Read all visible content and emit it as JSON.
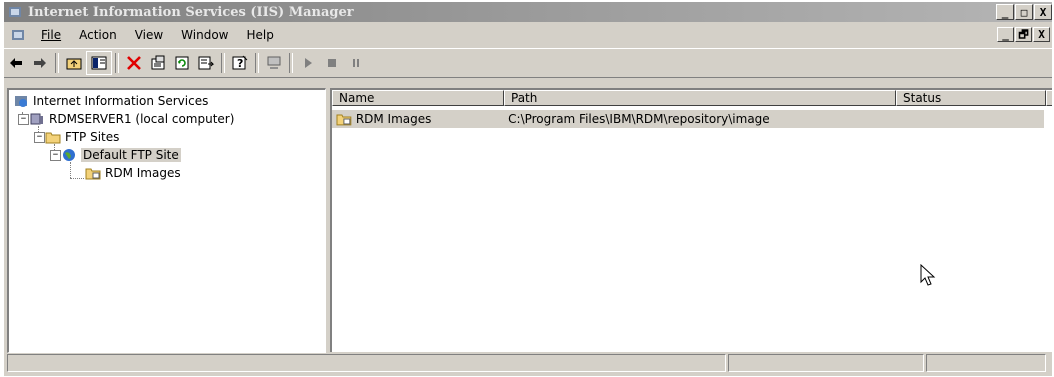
{
  "window": {
    "title": "Internet Information Services (IIS) Manager"
  },
  "caption_buttons": [
    "_",
    "□",
    "X"
  ],
  "mdi_buttons": [
    "_",
    "🗗",
    "X"
  ],
  "menu": [
    "File",
    "Action",
    "View",
    "Window",
    "Help"
  ],
  "toolbar": [
    "back-icon",
    "forward-icon",
    "up-folder-icon",
    "show-tree-icon",
    "delete-icon",
    "properties-icon",
    "refresh-icon",
    "export-list-icon",
    "help-icon",
    "computer-icon",
    "play-icon",
    "stop-icon",
    "pause-icon"
  ],
  "tree": {
    "root": "Internet Information Services",
    "server": "RDMSERVER1 (local computer)",
    "ftp_sites": "FTP Sites",
    "default_site": "Default FTP Site",
    "vdir": "RDM Images"
  },
  "list": {
    "columns": [
      "Name",
      "Path",
      "Status"
    ],
    "rows": [
      {
        "name": "RDM Images",
        "path": "C:\\Program Files\\IBM\\RDM\\repository\\image",
        "status": ""
      }
    ]
  },
  "colors": {
    "face": "#d4d0c8",
    "title_gradient_start": "#808080",
    "selection": "#d4d0c8"
  }
}
